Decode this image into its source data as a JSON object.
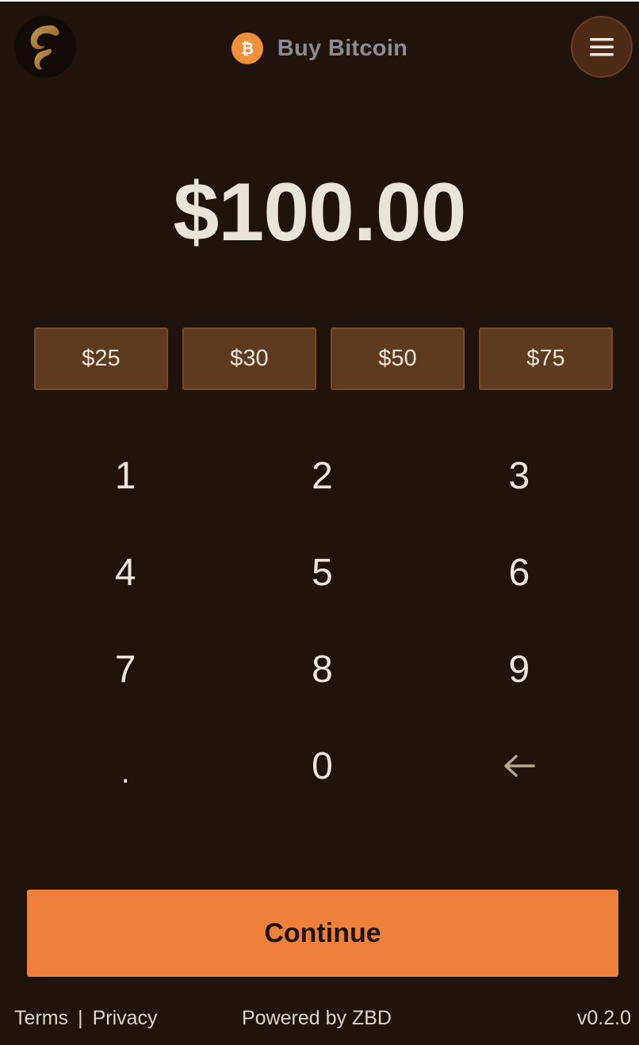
{
  "header": {
    "logo_icon": "brand-logo-icon",
    "title_icon": "bitcoin-icon",
    "title": "Buy Bitcoin",
    "menu_icon": "hamburger-menu-icon"
  },
  "amount": {
    "display": "$100.00"
  },
  "presets": [
    {
      "label": "$25"
    },
    {
      "label": "$30"
    },
    {
      "label": "$50"
    },
    {
      "label": "$75"
    }
  ],
  "keypad": {
    "keys": [
      "1",
      "2",
      "3",
      "4",
      "5",
      "6",
      "7",
      "8",
      "9",
      ".",
      "0"
    ],
    "backspace_icon": "backspace-arrow-icon"
  },
  "actions": {
    "continue_label": "Continue"
  },
  "footer": {
    "terms": "Terms",
    "separator": "|",
    "privacy": "Privacy",
    "powered_by": "Powered by ZBD",
    "version": "v0.2.0"
  },
  "colors": {
    "background": "#1f130c",
    "accent": "#ed803a",
    "preset_button": "#5e3a1f",
    "bitcoin": "#f0913a"
  }
}
